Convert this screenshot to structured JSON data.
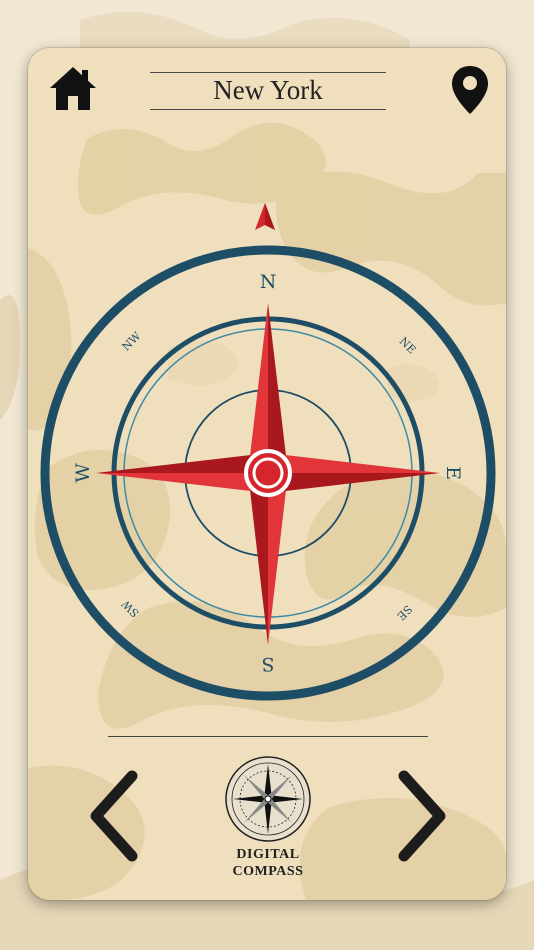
{
  "header": {
    "city": "New York",
    "home_icon": "home-icon",
    "location_icon": "map-pin-icon"
  },
  "compass": {
    "cardinals": {
      "n": "N",
      "e": "E",
      "s": "S",
      "w": "W"
    },
    "intercardinals": {
      "ne": "NE",
      "se": "SE",
      "sw": "SW",
      "nw": "NW"
    },
    "colors": {
      "ring": "#1e4d66",
      "star": "#d6262d",
      "star_dark": "#a8181d",
      "pointer": "#d6262d"
    }
  },
  "footer": {
    "logo_line1": "DIGITAL",
    "logo_line2": "COMPASS",
    "prev_icon": "chevron-left-icon",
    "next_icon": "chevron-right-icon"
  }
}
